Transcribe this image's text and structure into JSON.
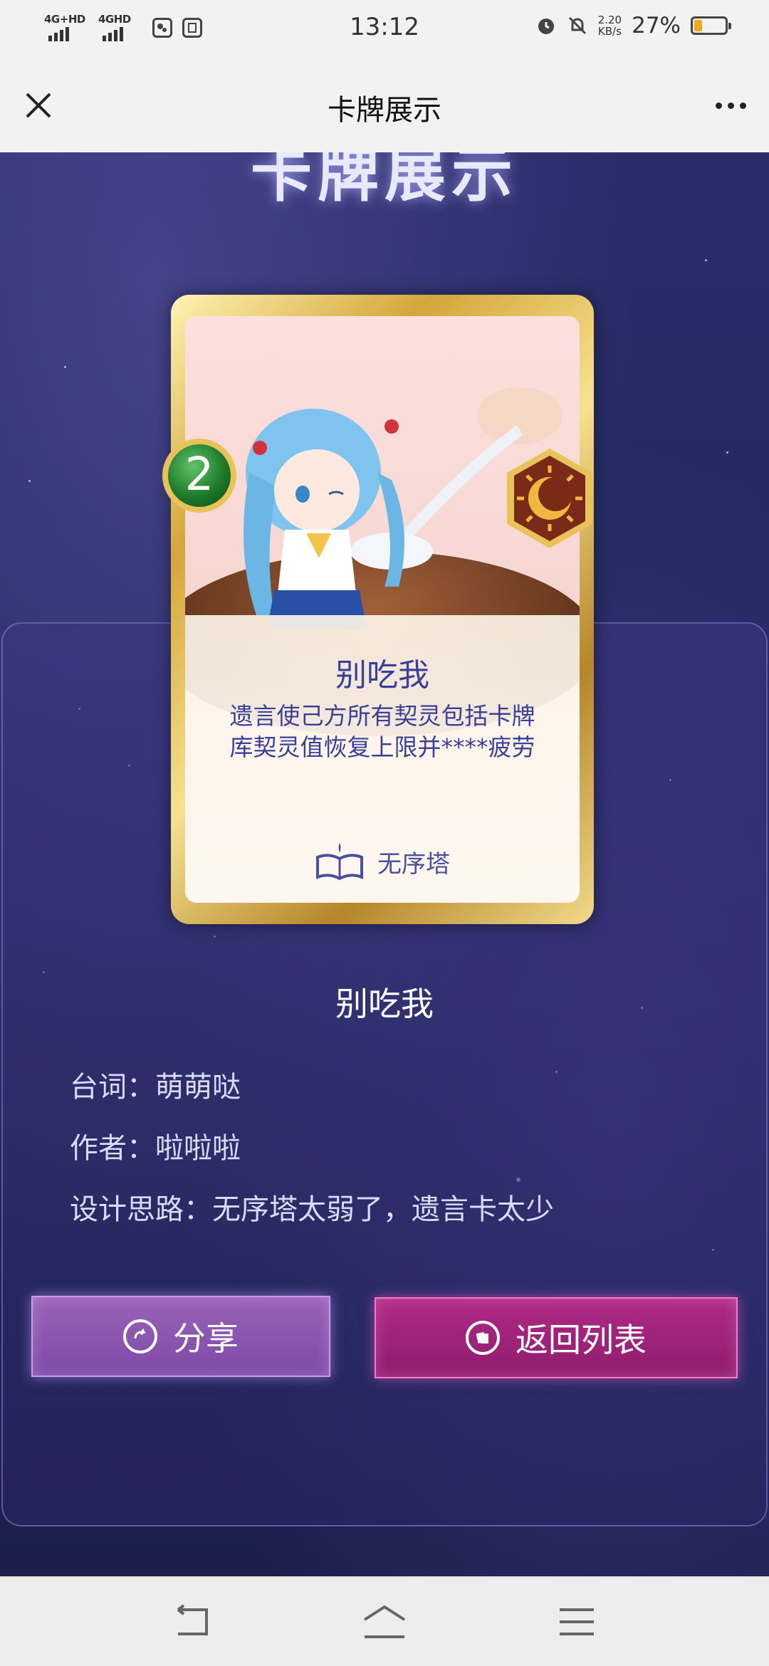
{
  "status_bar": {
    "network_1": "4G+HD",
    "network_2": "4GHD",
    "time": "13:12",
    "speed_value": "2.20",
    "speed_unit": "KB/s",
    "battery_percent_text": "27%",
    "battery_level": 0.27
  },
  "nav": {
    "title": "卡牌展示"
  },
  "banner": {
    "title": "卡牌展示"
  },
  "card": {
    "cost": "2",
    "name": "别吃我",
    "description_line1": "遗言使己方所有契灵包括卡牌",
    "description_line2": "库契灵值恢复上限并****疲劳",
    "faction": "无序塔",
    "colors": {
      "frame": "#d4a63a",
      "cost_badge": "#1e7a2a",
      "text": "#3a3f9a"
    }
  },
  "details": {
    "title": "别吃我",
    "line_label_label": "台词：",
    "line_value": "萌萌哒",
    "author_label": "作者：",
    "author_value": "啦啦啦",
    "design_label": "设计思路：",
    "design_value": "无序塔太弱了，遗言卡太少"
  },
  "buttons": {
    "share": "分享",
    "back": "返回列表"
  }
}
